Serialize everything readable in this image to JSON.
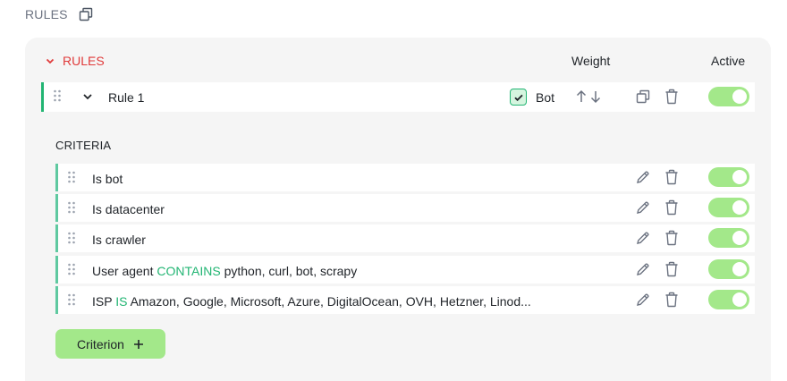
{
  "header": {
    "title": "RULES",
    "copy_icon": "copy-icon"
  },
  "rules": {
    "section_label": "RULES",
    "columns": {
      "weight": "Weight",
      "active": "Active"
    },
    "rule": {
      "name": "Rule 1",
      "bot_checked": true,
      "bot_label": "Bot",
      "active": true
    },
    "criteria_title": "CRITERIA",
    "criteria": [
      {
        "text": "Is bot",
        "operator": "",
        "value": "",
        "active": true
      },
      {
        "text": "Is datacenter",
        "operator": "",
        "value": "",
        "active": true
      },
      {
        "text": "Is crawler",
        "operator": "",
        "value": "",
        "active": true
      },
      {
        "text": "User agent",
        "operator": "CONTAINS",
        "value": "python, curl, bot, scrapy",
        "active": true
      },
      {
        "text": "ISP",
        "operator": "IS",
        "value": "Amazon, Google, Microsoft, Azure, DigitalOcean, OVH, Hetzner, Linod...",
        "active": true
      }
    ],
    "add_button_label": "Criterion"
  },
  "colors": {
    "accent_green": "#22b573",
    "toggle_green": "#a3e88a",
    "rules_red": "#e03a3a",
    "panel_bg": "#f5f5f5"
  }
}
